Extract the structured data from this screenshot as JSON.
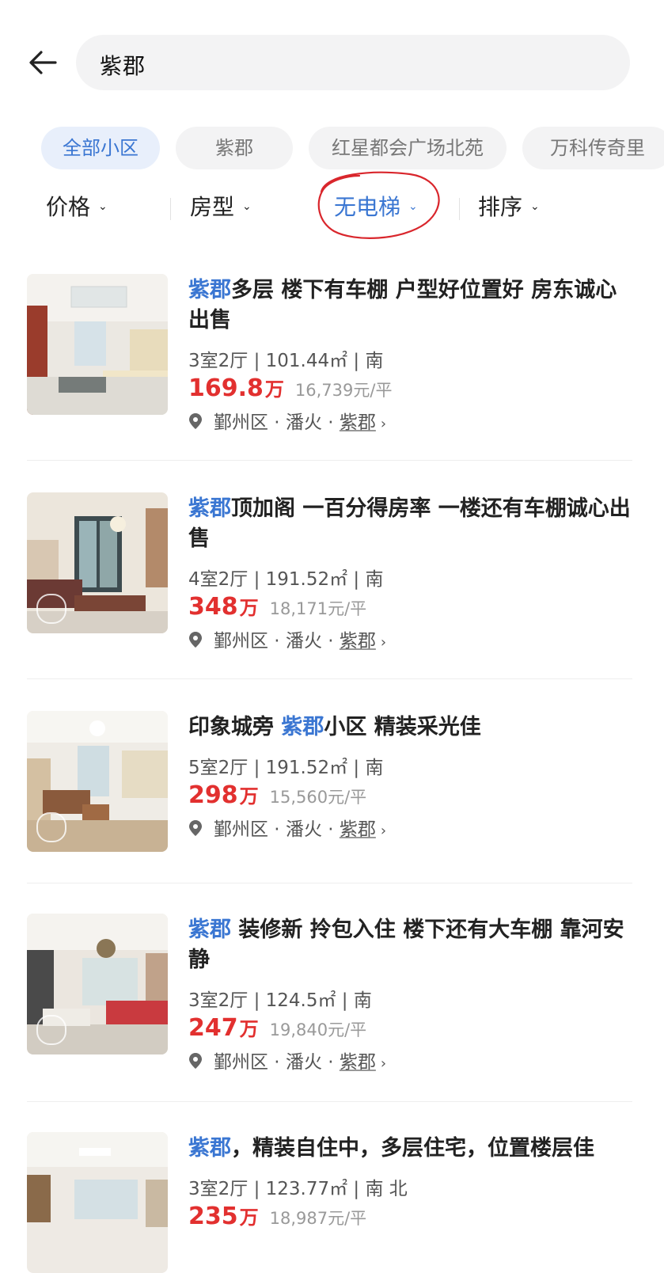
{
  "search": {
    "query": "紫郡"
  },
  "chips": [
    {
      "label": "全部小区",
      "active": true
    },
    {
      "label": "紫郡",
      "active": false
    },
    {
      "label": "红星都会广场北苑",
      "active": false
    },
    {
      "label": "万科传奇里",
      "active": false
    }
  ],
  "filters": [
    {
      "label": "价格",
      "active": false
    },
    {
      "label": "房型",
      "active": false
    },
    {
      "label": "无电梯",
      "active": true
    },
    {
      "label": "排序",
      "active": false
    }
  ],
  "listings": [
    {
      "title_highlight": "紫郡",
      "title_pre": "",
      "title_rest": "多层 楼下有车棚 户型好位置好 房东诚心出售",
      "specs": "3室2厅 | 101.44㎡ | 南",
      "price": "169.8",
      "price_unit": "万",
      "unit_price": "16,739元/平",
      "district": "鄞州区",
      "area": "潘火",
      "community": "紫郡"
    },
    {
      "title_highlight": "紫郡",
      "title_pre": "",
      "title_rest": "顶加阁 一百分得房率 一楼还有车棚诚心出售",
      "specs": "4室2厅 | 191.52㎡ | 南",
      "price": "348",
      "price_unit": "万",
      "unit_price": "18,171元/平",
      "district": "鄞州区",
      "area": "潘火",
      "community": "紫郡"
    },
    {
      "title_highlight": "紫郡",
      "title_pre": "印象城旁 ",
      "title_rest": "小区 精装采光佳",
      "specs": "5室2厅 | 191.52㎡ | 南",
      "price": "298",
      "price_unit": "万",
      "unit_price": "15,560元/平",
      "district": "鄞州区",
      "area": "潘火",
      "community": "紫郡"
    },
    {
      "title_highlight": "紫郡",
      "title_pre": "",
      "title_rest": " 装修新 拎包入住 楼下还有大车棚 靠河安静",
      "specs": "3室2厅 | 124.5㎡ | 南",
      "price": "247",
      "price_unit": "万",
      "unit_price": "19,840元/平",
      "district": "鄞州区",
      "area": "潘火",
      "community": "紫郡"
    },
    {
      "title_highlight": "紫郡",
      "title_pre": "",
      "title_rest": "，精装自住中，多层住宅，位置楼层佳",
      "specs": "3室2厅 | 123.77㎡ | 南 北",
      "price": "235",
      "price_unit": "万",
      "unit_price": "18,987元/平",
      "district": "",
      "area": "",
      "community": ""
    }
  ],
  "colors": {
    "accent": "#3a76d2",
    "price": "#e2302f",
    "annotation": "#d9262c"
  }
}
